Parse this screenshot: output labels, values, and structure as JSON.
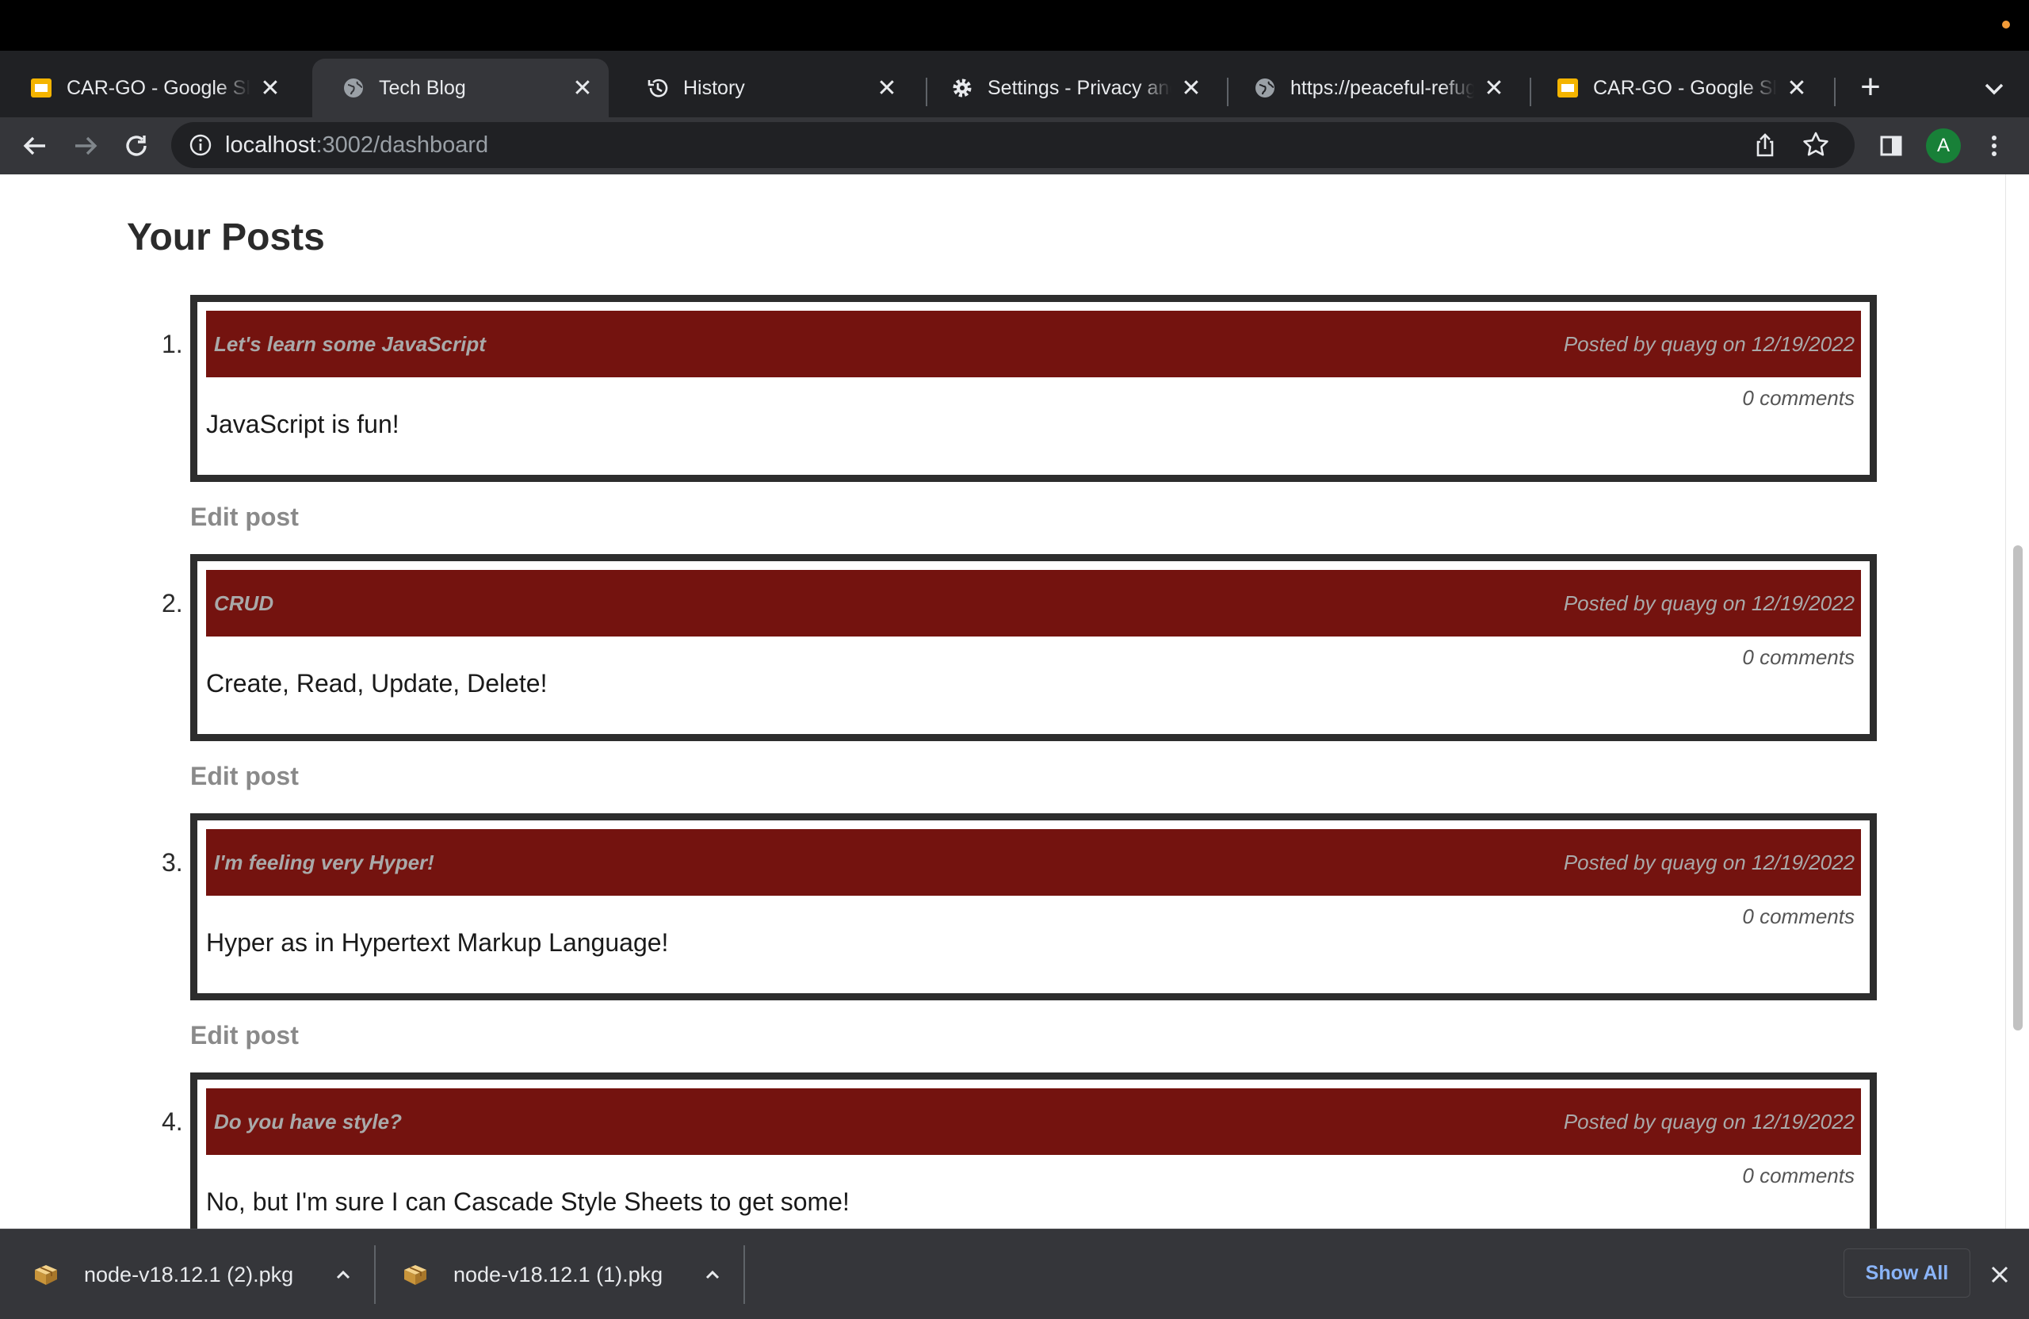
{
  "browser": {
    "tabs": [
      {
        "title": "CAR-GO - Google Slides",
        "icon": "google-slides-icon",
        "active": false
      },
      {
        "title": "Tech Blog",
        "icon": "globe-icon",
        "active": true
      },
      {
        "title": "History",
        "icon": "history-icon",
        "active": false
      },
      {
        "title": "Settings - Privacy and security",
        "icon": "gear-icon",
        "active": false
      },
      {
        "title": "https://peaceful-refuge",
        "icon": "globe-icon",
        "active": false
      },
      {
        "title": "CAR-GO - Google Slides",
        "icon": "google-slides-icon",
        "active": false
      }
    ],
    "url_host": "localhost",
    "url_path": ":3002/dashboard",
    "profile_initial": "A"
  },
  "page": {
    "heading": "Your Posts",
    "edit_label": "Edit post",
    "posts": [
      {
        "number": "1.",
        "title": "Let's learn some JavaScript",
        "meta": "Posted by quayg on 12/19/2022",
        "comments": "0 comments",
        "body": "JavaScript is fun!"
      },
      {
        "number": "2.",
        "title": "CRUD",
        "meta": "Posted by quayg on 12/19/2022",
        "comments": "0 comments",
        "body": "Create, Read, Update, Delete!"
      },
      {
        "number": "3.",
        "title": "I'm feeling very Hyper!",
        "meta": "Posted by quayg on 12/19/2022",
        "comments": "0 comments",
        "body": "Hyper as in Hypertext Markup Language!"
      },
      {
        "number": "4.",
        "title": "Do you have style?",
        "meta": "Posted by quayg on 12/19/2022",
        "comments": "0 comments",
        "body": "No, but I'm sure I can Cascade Style Sheets to get some!"
      }
    ]
  },
  "downloads": {
    "items": [
      {
        "name": "node-v18.12.1 (2).pkg"
      },
      {
        "name": "node-v18.12.1 (1).pkg"
      }
    ],
    "show_all_label": "Show All"
  },
  "colors": {
    "post_header_bg": "#74130f",
    "post_border": "#2d2d2d",
    "browser_dark": "#202124",
    "toolbar": "#35363a"
  }
}
